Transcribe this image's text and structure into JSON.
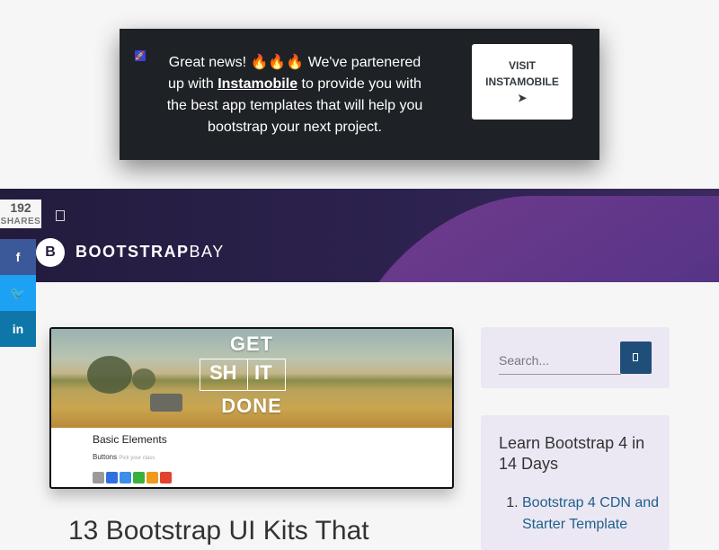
{
  "promo": {
    "icon": "rocket-icon",
    "msg_part1": "Great news! ",
    "msg_emoji": "🔥🔥🔥",
    "msg_part2": " We've partenered up with ",
    "msg_link": "Instamobile",
    "msg_part3": " to provide you with the best app templates that will help you bootstrap your next project.",
    "cta_line1": "VISIT",
    "cta_line2": "INSTAMOBILE",
    "cta_arrow": "➤"
  },
  "header": {
    "logo_letter": "B",
    "brand_bold": "BOOTSTRAP",
    "brand_light": "BAY"
  },
  "share": {
    "count": "192",
    "label": "SHARES",
    "facebook": "f",
    "twitter": "🐦",
    "linkedin": "in"
  },
  "featured": {
    "headline_1": "GET",
    "headline_2a": "SH",
    "headline_2b": "IT",
    "headline_3": "DONE",
    "section_title": "Basic Elements",
    "buttons_label": "Buttons",
    "buttons_hint": "Pick your class",
    "swatch_colors": [
      "#9a9a9a",
      "#2f6fe0",
      "#3b8fe8",
      "#3ab13a",
      "#ef9a1b",
      "#e2422f"
    ]
  },
  "article": {
    "title": "13 Bootstrap UI Kits That"
  },
  "search": {
    "placeholder": "Search..."
  },
  "learn": {
    "title": "Learn Bootstrap 4 in 14 Days",
    "items": [
      "Bootstrap 4 CDN and Starter Template"
    ]
  }
}
